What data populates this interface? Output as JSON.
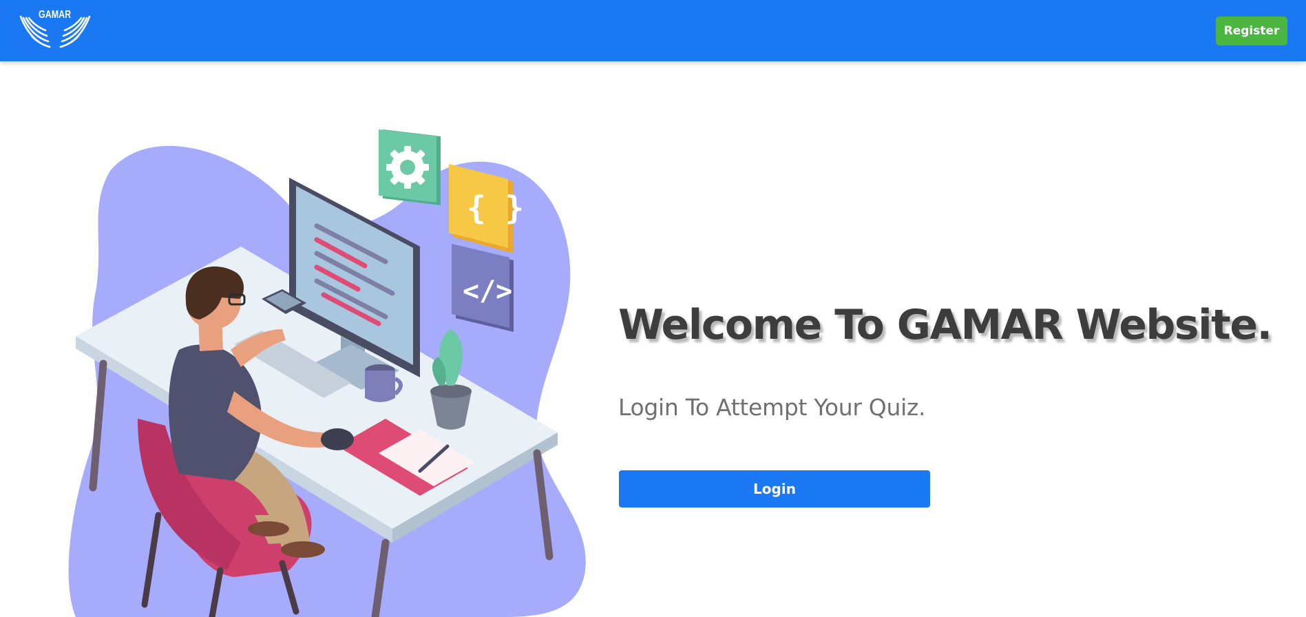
{
  "navbar": {
    "logo_text": "GAMAR",
    "register_label": "Register",
    "background_color": "#1a78f2",
    "register_color": "#4ab53f"
  },
  "hero": {
    "headline": "Welcome To GAMAR Website.",
    "subline": "Login To Attempt Your Quiz.",
    "login_label": "Login",
    "illustration_icons": [
      "gear-icon",
      "curly-braces-icon",
      "code-icon"
    ]
  }
}
